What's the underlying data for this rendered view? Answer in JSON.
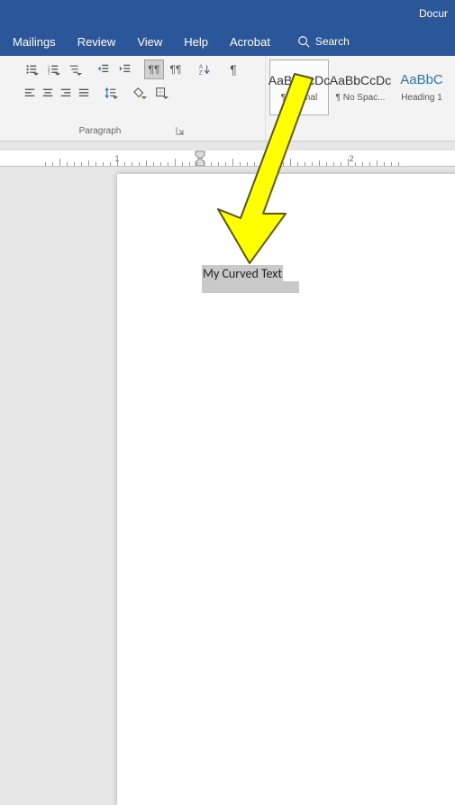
{
  "title": "Docur",
  "tabs": [
    "Mailings",
    "Review",
    "View",
    "Help",
    "Acrobat"
  ],
  "search": {
    "label": "Search"
  },
  "paragraph": {
    "group_label": "Paragraph",
    "buttons": {
      "bullets": "Bullets",
      "numbering": "Numbering",
      "multilevel": "Multilevel List",
      "indent_dec": "Decrease Indent",
      "indent_inc": "Increase Indent",
      "marks": "Show/Hide ¶",
      "sort": "Sort",
      "align_left": "Align Left",
      "align_center": "Center",
      "align_right": "Align Right",
      "justify": "Justify",
      "spacing": "Line Spacing",
      "shading": "Shading",
      "borders": "Borders"
    }
  },
  "styles": {
    "preview_text": "AaBbCcDc",
    "heading_preview": "AaBbC",
    "items": [
      {
        "name": "¶ Normal",
        "selected": true
      },
      {
        "name": "¶ No Spac...",
        "selected": false
      },
      {
        "name": "Heading 1",
        "selected": false
      }
    ]
  },
  "ruler": {
    "marks": [
      "1",
      "2"
    ]
  },
  "document": {
    "selected_text": "My Curved Text"
  },
  "colors": {
    "brand": "#2b579a",
    "arrow": "#ffff00",
    "arrow_stroke": "#5a5a00"
  }
}
